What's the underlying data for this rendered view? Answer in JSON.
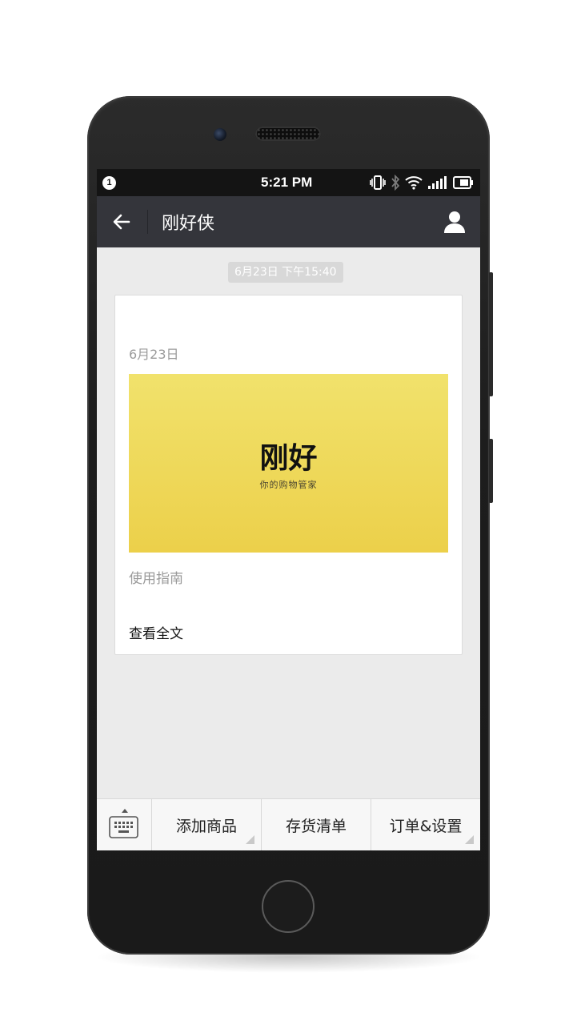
{
  "status_bar": {
    "notification_count": "1",
    "time": "5:21 PM",
    "icons": [
      "vibrate-icon",
      "bluetooth-icon",
      "wifi-icon",
      "signal-icon",
      "battery-icon"
    ]
  },
  "header": {
    "title": "刚好侠",
    "back_icon": "back-arrow-icon",
    "profile_icon": "profile-icon"
  },
  "chat": {
    "timestamp": "6月23日 下午15:40",
    "card": {
      "date": "6月23日",
      "cover_title": "刚好",
      "cover_subtitle": "你的购物管家",
      "caption": "使用指南",
      "read_more": "查看全文"
    }
  },
  "menu": {
    "keyboard_icon": "keyboard-icon",
    "items": [
      {
        "label": "添加商品",
        "has_submenu": true
      },
      {
        "label": "存货清单",
        "has_submenu": false
      },
      {
        "label": "订单&设置",
        "has_submenu": true
      }
    ]
  },
  "colors": {
    "header_bg": "#34353b",
    "status_bg": "#141414",
    "chat_bg": "#ebebeb",
    "cover_yellow": "#f1e26c"
  }
}
